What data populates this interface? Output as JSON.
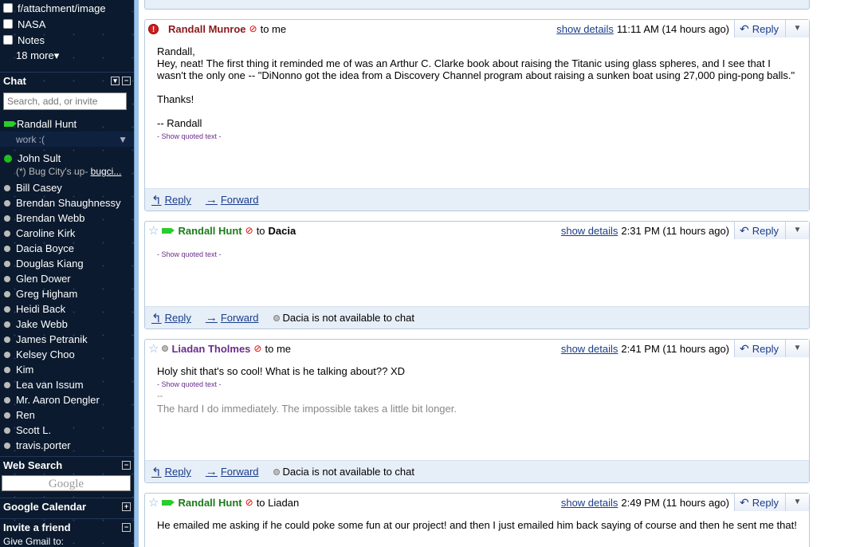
{
  "sidebar": {
    "labels": [
      "f/attachment/image",
      "NASA",
      "Notes"
    ],
    "more": "18 more▾",
    "chat": {
      "title": "Chat",
      "search_placeholder": "Search, add, or invite",
      "me": {
        "name": "Randall Hunt",
        "status": "work :("
      },
      "online": {
        "name": "John Sult",
        "status_prefix": "(*) Bug City's up- ",
        "status_link": "bugci..."
      },
      "contacts": [
        "Bill Casey",
        "Brendan Shaughnessy",
        "Brendan Webb",
        "Caroline Kirk",
        "Dacia Boyce",
        "Douglas Kiang",
        "Glen Dower",
        "Greg Higham",
        "Heidi Back",
        "Jake Webb",
        "James Petranik",
        "Kelsey Choo",
        "Kim",
        "Lea van Issum",
        "Mr. Aaron Dengler",
        "Ren",
        "Scott L.",
        "travis.porter"
      ]
    },
    "web_search": {
      "title": "Web Search",
      "logo": "Google"
    },
    "calendar": {
      "title": "Google Calendar"
    },
    "invite": {
      "title": "Invite a friend",
      "text": "Give Gmail to:"
    }
  },
  "messages": [
    {
      "sender": "Randall Munroe",
      "to": "to me",
      "details": "show details",
      "time": "11:11 AM (14 hours ago)",
      "reply": "Reply",
      "body_lines": [
        "Randall,",
        "Hey, neat!  The first thing it reminded me of was an Arthur C. Clarke book about raising the Titanic using glass spheres, and I see that I wasn't the only one -- \"DiNonno got the idea from a Discovery Channel program about raising a sunken boat using 27,000 ping-pong balls.\"",
        "Thanks!",
        "-- Randall"
      ],
      "quoted": "- Show quoted text -",
      "foot_reply": "Reply",
      "foot_forward": "Forward"
    },
    {
      "sender": "Randall Hunt",
      "to_prefix": "to",
      "to_name": "Dacia",
      "details": "show details",
      "time": "2:31 PM (11 hours ago)",
      "reply": "Reply",
      "quoted": "- Show quoted text -",
      "foot_reply": "Reply",
      "foot_forward": "Forward",
      "foot_status": "Dacia is not available to chat"
    },
    {
      "sender": "Liadan Tholmes",
      "to": "to me",
      "details": "show details",
      "time": "2:41 PM (11 hours ago)",
      "reply": "Reply",
      "body": "Holy shit that's so cool! What is he talking about?? XD",
      "quoted": "- Show quoted text -",
      "sig_dash": "--",
      "sig": "The hard I do immediately. The impossible takes a little bit longer.",
      "foot_reply": "Reply",
      "foot_forward": "Forward",
      "foot_status": "Dacia is not available to chat"
    },
    {
      "sender": "Randall Hunt",
      "to": "to Liadan",
      "details": "show details",
      "time": "2:49 PM (11 hours ago)",
      "reply": "Reply",
      "body": "He emailed me asking if he could poke some fun at our project! and then I just emailed him back saying of course and then he sent me that!"
    }
  ]
}
